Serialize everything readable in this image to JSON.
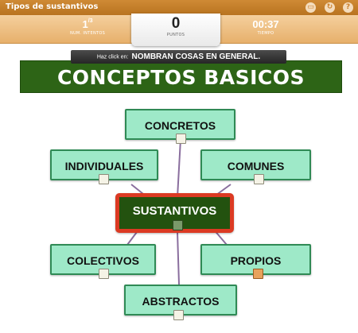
{
  "window": {
    "title": "Tipos de sustantivos"
  },
  "toolbar": {
    "icons": [
      "display-icon",
      "refresh-icon",
      "help-icon"
    ]
  },
  "stats": {
    "attempts_value": "1",
    "attempts_total": "/3",
    "attempts_label": "NUM. INTENTOS",
    "points_value": "0",
    "points_label": "PUNTOS",
    "time_value": "00:37",
    "time_label": "TIEMPO"
  },
  "instruction": {
    "prefix": "Haz click en:",
    "target": "NOMBRAN COSAS EN GENERAL."
  },
  "banner": {
    "title": "CONCEPTOS BASICOS"
  },
  "nodes": {
    "concretos": "CONCRETOS",
    "individuales": "INDIVIDUALES",
    "comunes": "COMUNES",
    "sustantivos": "SUSTANTIVOS",
    "colectivos": "COLECTIVOS",
    "propios": "PROPIOS",
    "abstractos": "ABSTRACTOS"
  },
  "colors": {
    "header_orange": "#e7b06b",
    "banner_green": "#2d6416",
    "node_fill": "#9ee9c8",
    "node_border": "#2f8a55",
    "center_border": "#dc3a23",
    "line_purple": "#8a6e9e"
  }
}
